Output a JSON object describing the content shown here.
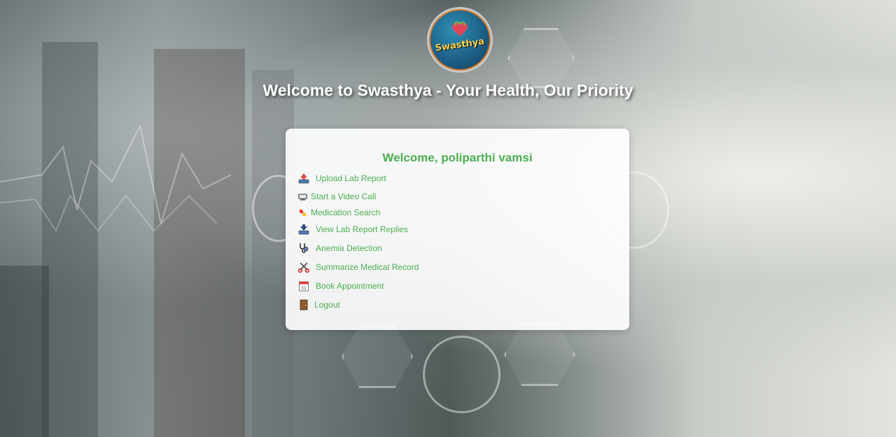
{
  "brand": {
    "logo_text": "Swasthya",
    "headline": "Welcome to Swasthya - Your Health, Our Priority"
  },
  "card": {
    "greeting": "Welcome, poliparthi vamsi",
    "menu": [
      {
        "label": "Upload Lab Report",
        "icon": "upload-icon"
      },
      {
        "label": "Start a Video Call",
        "icon": "video-call-icon"
      },
      {
        "label": "Medication Search",
        "icon": "pill-icon"
      },
      {
        "label": "View Lab Report Replies",
        "icon": "inbox-tray-icon"
      },
      {
        "label": "Anemia Detection",
        "icon": "stethoscope-icon"
      },
      {
        "label": "Summarize Medical Record",
        "icon": "scissors-icon"
      },
      {
        "label": "Book Appointment",
        "icon": "calendar-icon"
      },
      {
        "label": "Logout",
        "icon": "door-icon"
      }
    ]
  },
  "colors": {
    "accent": "#4caf50",
    "card_bg": "#ffffff",
    "headline": "#ffffff"
  }
}
